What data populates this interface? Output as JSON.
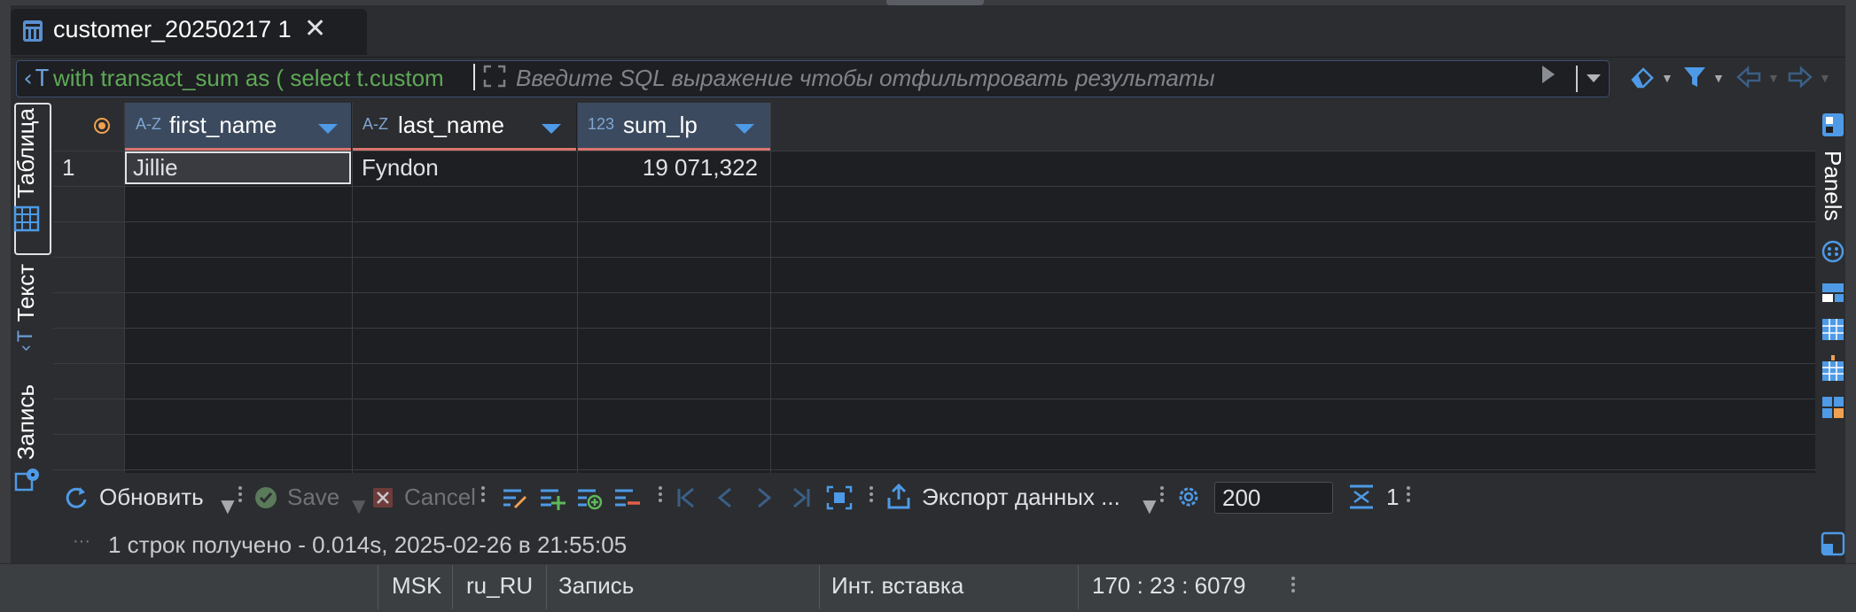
{
  "tab": {
    "title": "customer_20250217 1",
    "close": "✕"
  },
  "filter": {
    "sql_prefix_icon": "‹T",
    "sql_text": "with transact_sum as ( select t.custom",
    "placeholder": "Введите SQL выражение чтобы отфильтровать результаты"
  },
  "left_tabs": [
    {
      "label": "Таблица",
      "icon": "table-grid-icon",
      "active": true
    },
    {
      "label": "Текст",
      "icon": "text-icon",
      "active": false
    },
    {
      "label": "Запись",
      "icon": "record-icon",
      "active": false
    }
  ],
  "grid": {
    "columns": [
      {
        "type": "A-Z",
        "name": "first_name"
      },
      {
        "type": "A-Z",
        "name": "last_name"
      },
      {
        "type": "123",
        "name": "sum_lp"
      }
    ],
    "rows": [
      {
        "num": "1",
        "cells": [
          "Jillie",
          "Fyndon",
          "19 071,322"
        ]
      }
    ]
  },
  "right_panel": {
    "label": "Panels"
  },
  "bottom_toolbar": {
    "refresh": "Обновить",
    "save": "Save",
    "cancel": "Cancel",
    "export": "Экспорт данных ...",
    "limit": "200",
    "row_count": "1"
  },
  "status_line": "1 строк получено - 0.014s, 2025-02-26 в 21:55:05",
  "status_bar": {
    "timezone": "MSK",
    "locale": "ru_RU",
    "mode": "Запись",
    "insert_mode": "Инт. вставка",
    "position": "170 : 23 : 6079"
  },
  "colors": {
    "accent": "#4e9ae6",
    "sql_text": "#5fa858",
    "header_bg": "#3b4a5e",
    "header_underline": "#d9756d"
  }
}
